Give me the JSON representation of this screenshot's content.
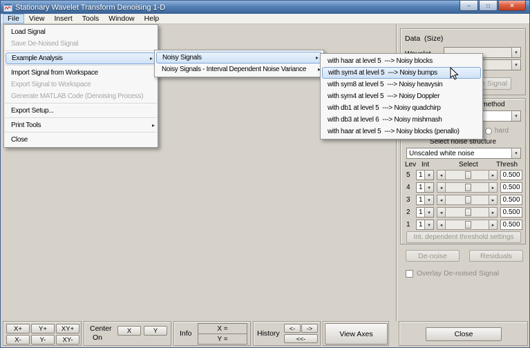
{
  "window": {
    "title": "Stationary Wavelet Transform Denoising 1-D"
  },
  "icons": {
    "minimize": "–",
    "maximize": "□",
    "close": "✕",
    "combo_arrow": "▾",
    "submenu_arrow": "▸",
    "slider_left": "◂",
    "slider_right": "▸"
  },
  "menubar": {
    "items": [
      "File",
      "View",
      "Insert",
      "Tools",
      "Window",
      "Help"
    ],
    "open": "File"
  },
  "menus": {
    "file": {
      "items": [
        {
          "label": "Load Signal"
        },
        {
          "label": "Save De-Noised Signal",
          "disabled": true,
          "sep_after": true
        },
        {
          "label": "Example Analysis",
          "submenu": true,
          "selected": true,
          "sep_after": true
        },
        {
          "label": "Import Signal from Workspace"
        },
        {
          "label": "Export Signal to Workspace",
          "disabled": true
        },
        {
          "label": "Generate MATLAB Code (Denoising Process)",
          "disabled": true,
          "sep_after": true
        },
        {
          "label": "Export Setup...",
          "sep_after": true
        },
        {
          "label": "Print Tools",
          "submenu": true,
          "sep_after": true
        },
        {
          "label": "Close"
        }
      ]
    },
    "example_analysis": {
      "items": [
        {
          "label": "Noisy Signals",
          "submenu": true,
          "selected": true
        },
        {
          "label": "Noisy Signals - Interval Dependent Noise Variance",
          "submenu": true
        }
      ]
    },
    "noisy_signals": {
      "items": [
        {
          "label": "with haar at level 5  ---> Noisy blocks"
        },
        {
          "label": "with sym4 at level 5  ---> Noisy bumps",
          "selected": true
        },
        {
          "label": "with sym8 at level 5  ---> Noisy heavysin"
        },
        {
          "label": "with sym4 at level 5  ---> Noisy Doppler"
        },
        {
          "label": "with db1 at level 5  ---> Noisy quadchirp"
        },
        {
          "label": "with db3 at level 6  ---> Noisy mishmash"
        },
        {
          "label": "with haar at level 5  ---> Noisy blocks (penallo)"
        }
      ]
    }
  },
  "panel": {
    "data_label": "Data  (Size)",
    "wavelet_label": "Wavelet",
    "decompose_button": "Decompose Signal",
    "thresholding_title": "Select thresholding method",
    "hard_radio": "hard",
    "noise_title": "Select noise structure",
    "noise_select": "Unscaled white noise",
    "table": {
      "headers": [
        "Lev",
        "Int",
        "Select",
        "Thresh"
      ],
      "rows": [
        {
          "lev": "5",
          "int": "1",
          "thresh": "0.500"
        },
        {
          "lev": "4",
          "int": "1",
          "thresh": "0.500"
        },
        {
          "lev": "3",
          "int": "1",
          "thresh": "0.500"
        },
        {
          "lev": "2",
          "int": "1",
          "thresh": "0.500"
        },
        {
          "lev": "1",
          "int": "1",
          "thresh": "0.500"
        }
      ]
    },
    "int_dep_button": "Int. dependent threshold settings",
    "denoise_button": "De-noise",
    "residuals_button": "Residuals",
    "overlay_checkbox": "Overlay De-noised Signal",
    "close_button": "Close"
  },
  "toolbar": {
    "zoom_buttons": [
      "X+",
      "Y+",
      "XY+",
      "X-",
      "Y-",
      "XY-"
    ],
    "center_label_1": "Center",
    "center_label_2": "On",
    "center_x": "X",
    "center_y": "Y",
    "info_label": "Info",
    "info_x": "X =",
    "info_y": "Y =",
    "history_label": "History",
    "history_back": "<-",
    "history_fwd": "->",
    "history_all": "<<-",
    "view_axes": "View Axes"
  }
}
